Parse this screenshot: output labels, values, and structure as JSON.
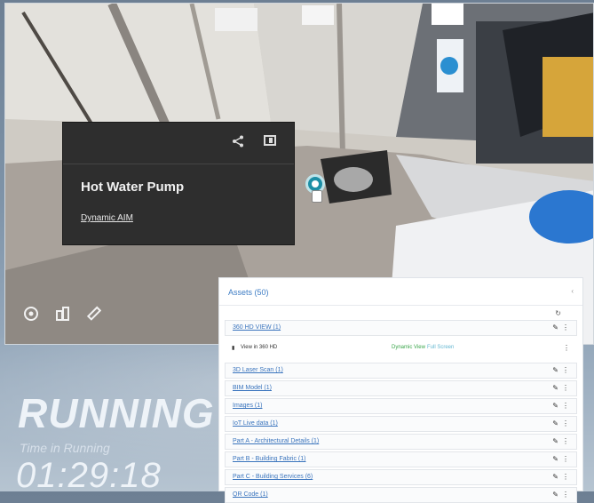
{
  "dashboard": {
    "status": "RUNNING",
    "time_label": "Time in Running",
    "time_value": "01:29:18"
  },
  "viewer": {
    "popup": {
      "title": "Hot Water Pump",
      "link": "Dynamic AIM",
      "share_icon": "share-icon",
      "panel_icon": "side-panel-icon"
    },
    "tools": [
      "navigate-icon",
      "measure-icon",
      "ruler-icon"
    ]
  },
  "assets": {
    "title": "Assets (50)",
    "refresh_icon": "refresh-icon",
    "rows": [
      {
        "label": "360 HD VIEW (1)",
        "expanded": true
      },
      {
        "label": "3D Laser Scan (1)"
      },
      {
        "label": "BIM Model (1)"
      },
      {
        "label": "Images (1)"
      },
      {
        "label": "IoT Live data (1)"
      },
      {
        "label": "Part A - Architectural Details (1)"
      },
      {
        "label": "Part B - Building Fabric (1)"
      },
      {
        "label": "Part C - Building Services (6)"
      },
      {
        "label": "QR Code (1)"
      }
    ],
    "subrow": {
      "label": "View in 360 HD",
      "dynamic_view": "Dynamic View",
      "full_screen": "Full Screen"
    }
  }
}
